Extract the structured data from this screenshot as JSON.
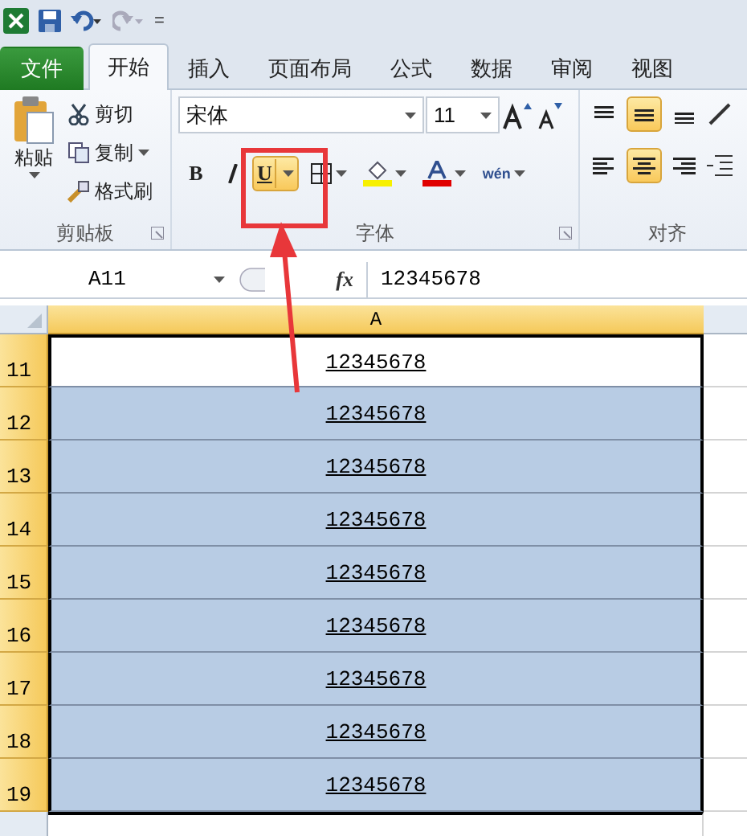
{
  "quick_access": {
    "separator_glyph": "="
  },
  "tabs": [
    {
      "label": "文件",
      "kind": "file",
      "selected": false
    },
    {
      "label": "开始",
      "kind": "tab",
      "selected": true
    },
    {
      "label": "插入",
      "kind": "tab",
      "selected": false
    },
    {
      "label": "页面布局",
      "kind": "tab",
      "selected": false
    },
    {
      "label": "公式",
      "kind": "tab",
      "selected": false
    },
    {
      "label": "数据",
      "kind": "tab",
      "selected": false
    },
    {
      "label": "审阅",
      "kind": "tab",
      "selected": false
    },
    {
      "label": "视图",
      "kind": "tab",
      "selected": false
    }
  ],
  "clipboard": {
    "paste": "粘贴",
    "cut": "剪切",
    "copy": "复制",
    "format_painter": "格式刷",
    "group_label": "剪贴板"
  },
  "font": {
    "name": "宋体",
    "size": "11",
    "bold": "B",
    "underline": "U",
    "underline_on": true,
    "group_label": "字体",
    "phonetic": "wén"
  },
  "alignment": {
    "group_label": "对齐",
    "top": false,
    "middle": true,
    "bottom": false,
    "left": false,
    "center": true,
    "right": false
  },
  "formula_bar": {
    "name_box": "A11",
    "fx": "fx",
    "value": "12345678"
  },
  "sheet": {
    "column": "A",
    "rows": [
      {
        "number": "11",
        "value": "12345678",
        "selected": false
      },
      {
        "number": "12",
        "value": "12345678",
        "selected": true
      },
      {
        "number": "13",
        "value": "12345678",
        "selected": true
      },
      {
        "number": "14",
        "value": "12345678",
        "selected": true
      },
      {
        "number": "15",
        "value": "12345678",
        "selected": true
      },
      {
        "number": "16",
        "value": "12345678",
        "selected": true
      },
      {
        "number": "17",
        "value": "12345678",
        "selected": true
      },
      {
        "number": "18",
        "value": "12345678",
        "selected": true
      },
      {
        "number": "19",
        "value": "12345678",
        "selected": true
      }
    ]
  }
}
